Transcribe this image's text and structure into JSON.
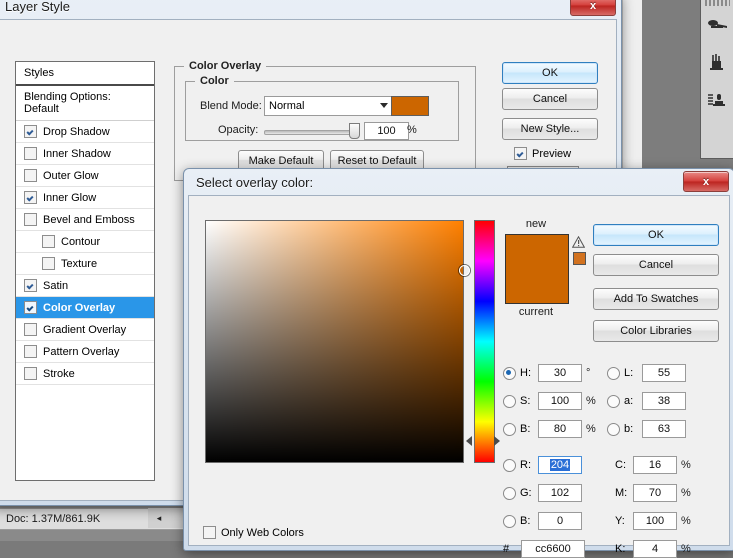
{
  "photoshop": {
    "status_doc": "Doc: 1.37M/861.9K",
    "scroll_right_icon": "▶",
    "scroll_left_icon": "◂",
    "tool_icons": [
      "spoon-brush-icon",
      "paint-bucket-icon",
      "stamp-icon"
    ]
  },
  "layer_style": {
    "title": "Layer Style",
    "close_label": "x",
    "styles_header": "Styles",
    "blending_options": "Blending Options: Default",
    "items": [
      {
        "label": "Drop Shadow",
        "checked": true,
        "indent": false,
        "selected": false
      },
      {
        "label": "Inner Shadow",
        "checked": false,
        "indent": false,
        "selected": false
      },
      {
        "label": "Outer Glow",
        "checked": false,
        "indent": false,
        "selected": false
      },
      {
        "label": "Inner Glow",
        "checked": true,
        "indent": false,
        "selected": false
      },
      {
        "label": "Bevel and Emboss",
        "checked": false,
        "indent": false,
        "selected": false
      },
      {
        "label": "Contour",
        "checked": false,
        "indent": true,
        "selected": false
      },
      {
        "label": "Texture",
        "checked": false,
        "indent": true,
        "selected": false
      },
      {
        "label": "Satin",
        "checked": true,
        "indent": false,
        "selected": false
      },
      {
        "label": "Color Overlay",
        "checked": true,
        "indent": false,
        "selected": true
      },
      {
        "label": "Gradient Overlay",
        "checked": false,
        "indent": false,
        "selected": false
      },
      {
        "label": "Pattern Overlay",
        "checked": false,
        "indent": false,
        "selected": false
      },
      {
        "label": "Stroke",
        "checked": false,
        "indent": false,
        "selected": false
      }
    ],
    "overlay_legend": "Color Overlay",
    "color_legend": "Color",
    "blend_mode_label": "Blend Mode:",
    "blend_mode_value": "Normal",
    "overlay_swatch_color": "#cc6600",
    "opacity_label": "Opacity:",
    "opacity_value": "100",
    "opacity_unit": "%",
    "make_default": "Make Default",
    "reset_default": "Reset to Default",
    "ok": "OK",
    "cancel": "Cancel",
    "new_style": "New Style...",
    "preview_label": "Preview",
    "preview_checked": true
  },
  "color_picker": {
    "title": "Select overlay color:",
    "close_label": "x",
    "new_label": "new",
    "current_label": "current",
    "new_color": "#cc6600",
    "current_color": "#cc6600",
    "warning_icon": "gamut-warning-icon",
    "warning_swatch_color": "#d2721f",
    "ok": "OK",
    "cancel": "Cancel",
    "add_to_swatches": "Add To Swatches",
    "color_libraries": "Color Libraries",
    "only_web_colors_label": "Only Web Colors",
    "only_web_colors_checked": false,
    "hex_symbol": "#",
    "hex_value": "cc6600",
    "selected_radio": "H",
    "selected_field": "R",
    "fields": {
      "hsb": [
        {
          "name": "H:",
          "value": "30",
          "unit": "°",
          "radio": true
        },
        {
          "name": "S:",
          "value": "100",
          "unit": "%",
          "radio": false
        },
        {
          "name": "B:",
          "value": "80",
          "unit": "%",
          "radio": false
        }
      ],
      "rgb": [
        {
          "name": "R:",
          "value": "204",
          "unit": "",
          "radio": false
        },
        {
          "name": "G:",
          "value": "102",
          "unit": "",
          "radio": false
        },
        {
          "name": "B:",
          "value": "0",
          "unit": "",
          "radio": false
        }
      ],
      "lab": [
        {
          "name": "L:",
          "value": "55",
          "unit": "",
          "radio": false
        },
        {
          "name": "a:",
          "value": "38",
          "unit": "",
          "radio": false
        },
        {
          "name": "b:",
          "value": "63",
          "unit": "",
          "radio": false
        }
      ],
      "cmyk": [
        {
          "name": "C:",
          "value": "16",
          "unit": "%"
        },
        {
          "name": "M:",
          "value": "70",
          "unit": "%"
        },
        {
          "name": "Y:",
          "value": "100",
          "unit": "%"
        },
        {
          "name": "K:",
          "value": "4",
          "unit": "%"
        }
      ]
    },
    "hue_base_color": "#ff8000"
  }
}
